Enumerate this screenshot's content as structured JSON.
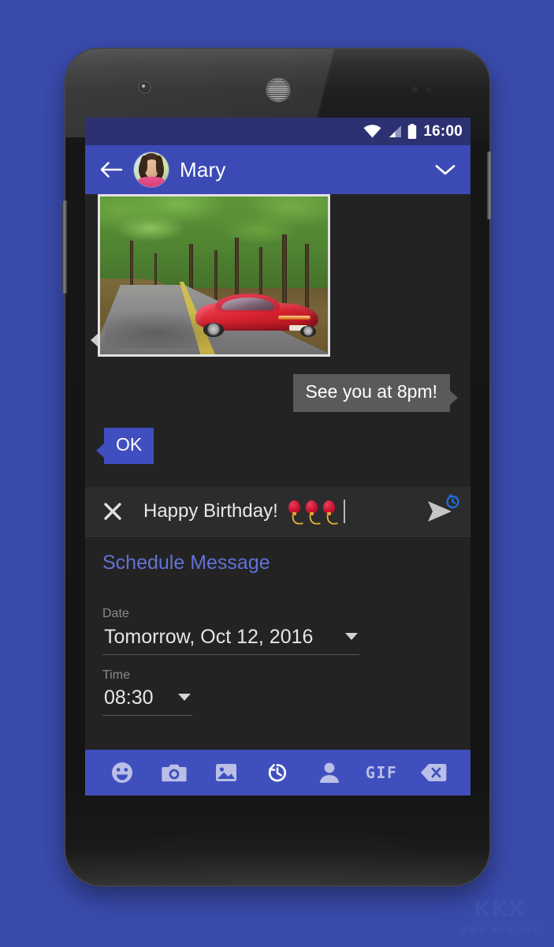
{
  "theme": {
    "page_background": "#3a4bad",
    "status_bar": "#2c3271",
    "app_bar": "#3c4ab5",
    "screen_background": "#232323",
    "compose_background": "#2c2c2c",
    "accent_blue": "#3f4fc0",
    "schedule_link": "#6272d8",
    "toolbar": "#3f4fbe",
    "out_bubble": "#5a5a5a"
  },
  "status_bar": {
    "time": "16:00",
    "icons": [
      "wifi-icon",
      "cellular-signal-icon",
      "battery-icon"
    ]
  },
  "app_bar": {
    "back_icon": "back-arrow-icon",
    "avatar": "contact-avatar",
    "contact_name": "Mary",
    "expand_icon": "chevron-down-icon"
  },
  "messages": [
    {
      "id": "photo",
      "direction": "incoming",
      "type": "image",
      "description": "red sports car on a tree-lined road"
    },
    {
      "id": "see-you",
      "direction": "outgoing",
      "type": "text",
      "text": "See you at 8pm!"
    },
    {
      "id": "ok",
      "direction": "incoming",
      "type": "text",
      "text": "OK"
    }
  ],
  "compose": {
    "clear_icon": "close-icon",
    "text": "Happy Birthday!",
    "emojis": [
      "balloon-emoji",
      "balloon-emoji",
      "balloon-emoji"
    ],
    "caret_visible": true,
    "send_icon": "send-icon",
    "send_badge_icon": "schedule-clock-icon"
  },
  "schedule": {
    "title": "Schedule Message",
    "date": {
      "label": "Date",
      "value": "Tomorrow, Oct 12, 2016",
      "dropdown_icon": "caret-down-icon"
    },
    "time": {
      "label": "Time",
      "value": "08:30",
      "dropdown_icon": "caret-down-icon"
    }
  },
  "toolbar": {
    "items": [
      {
        "name": "emoji-button",
        "icon": "smiley-icon",
        "label": ""
      },
      {
        "name": "camera-button",
        "icon": "camera-icon",
        "label": ""
      },
      {
        "name": "gallery-button",
        "icon": "image-icon",
        "label": ""
      },
      {
        "name": "schedule-button",
        "icon": "clock-history-icon",
        "label": "",
        "active": true
      },
      {
        "name": "contact-button",
        "icon": "person-icon",
        "label": ""
      },
      {
        "name": "gif-button",
        "icon": "gif-icon",
        "label": "GIF"
      },
      {
        "name": "backspace-button",
        "icon": "backspace-icon",
        "label": ""
      }
    ]
  },
  "watermark": {
    "logo": "KKX",
    "url": "www.kkx.net"
  }
}
